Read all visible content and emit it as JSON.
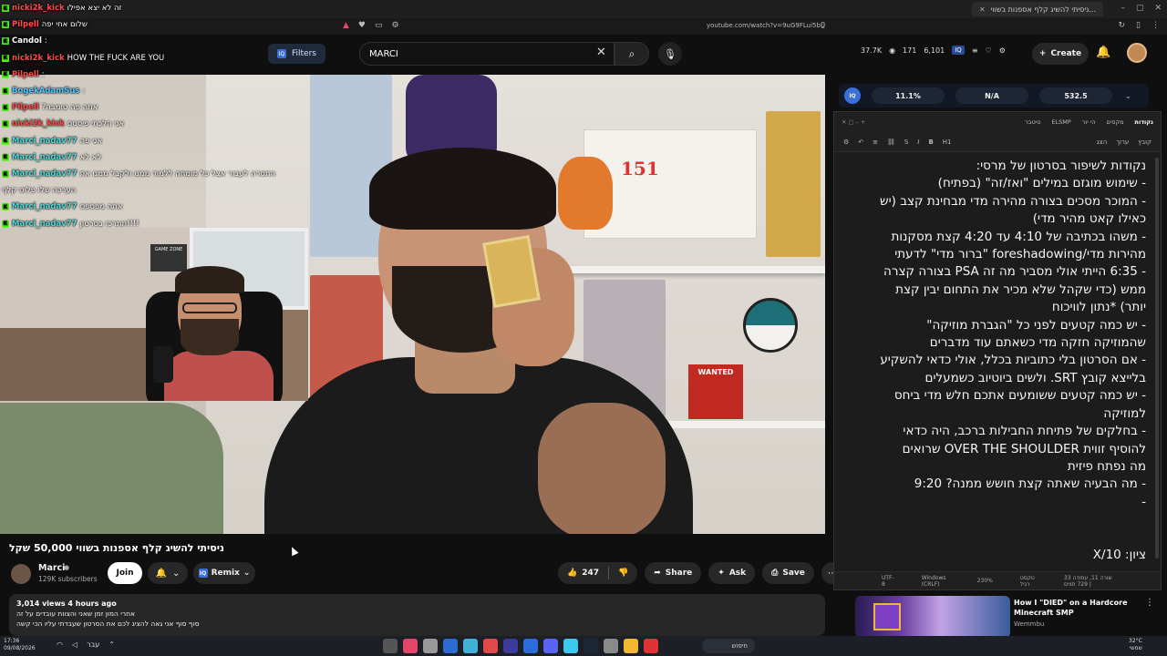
{
  "browser": {
    "tab_title": "ניסיתי להשיג קלף אספנות בשווי...",
    "url": "youtube.com/watch?v=9uG9FLui5bU"
  },
  "header": {
    "filters_label": "Filters",
    "search_value": "MARCI",
    "create_label": "Create",
    "ext_stats": {
      "views": "37.7K",
      "watching": "171",
      "other": "6,101"
    }
  },
  "chat": [
    {
      "user": "nicki2k_kick",
      "message": "זה לא יצא אפילו",
      "color": "#ff4a4a"
    },
    {
      "user": "Pilpell",
      "message": "שלום אחי יפה",
      "color": "#ff4a4a"
    },
    {
      "user": "Candol",
      "message": ":",
      "color": "#ffffff"
    },
    {
      "user": "nicki2k_kick",
      "message": "HOW THE FUCK ARE YOU",
      "color": "#ff4a4a"
    },
    {
      "user": "Pilpell",
      "message": ":",
      "color": "#ff4a4a"
    },
    {
      "user": "BogekAdamSus",
      "message": ":",
      "color": "#53c9ff"
    },
    {
      "user": "Pilpell",
      "message": "?אתה פה טומבה",
      "color": "#ff4a4a"
    },
    {
      "user": "nicki2k_kick",
      "message": "אני הלכתי פיססס",
      "color": "#ff4a4a"
    },
    {
      "user": "Marci_nadav77",
      "message": "אני פה",
      "color": "#4fd7d7"
    },
    {
      "user": "Marci_nadav77",
      "message": "לא לא",
      "color": "#4fd7d7"
    },
    {
      "user": "Marci_nadav77",
      "message": "התסרה לעבור אצל כל מומחה ללמוד ממנו ולקבל ממנו את",
      "color": "#4fd7d7"
    },
    {
      "user": "",
      "message": "הערכה שלו פלוס קלף",
      "color": "#ffffff"
    },
    {
      "user": "Marci_nadav77",
      "message": "אתה מפספס",
      "color": "#4fd7d7"
    },
    {
      "user": "Marci_nadav77",
      "message": "תתרכז בסרטון!!!!",
      "color": "#4fd7d7"
    }
  ],
  "video": {
    "title": "ניסיתי להשיג קלף אספנות בשווי 50,000 שקל",
    "channel": "Marci",
    "subscribers": "129K subscribers",
    "join_label": "Join",
    "remix_label": "Remix",
    "likes": "247",
    "share_label": "Share",
    "ask_label": "Ask",
    "save_label": "Save",
    "views_meta": "3,014 views  4 hours ago",
    "desc_line1": "אחרי המון זמן שאני והצוות עובדים על זה",
    "desc_line2": "סוף סוף אני גאה להציג לכם את הסרטון שעבדתי עליו הכי קשה",
    "scene_box_label": "151",
    "scene_wanted": "WANTED",
    "scene_gamezone": "GAME ZONE"
  },
  "extension": {
    "v1": "11.1%",
    "v2": "N/A",
    "v3": "532.5"
  },
  "notepad": {
    "tabs": [
      "טיטבר",
      "ELSMP",
      "הי יור",
      "מקסים",
      "נקודות"
    ],
    "menu": [
      "קובץ",
      "ערוך",
      "הצג"
    ],
    "heading_label": "H1",
    "lines": [
      "נקודות לשיפור בסרטון של מרסי:",
      "- שימוש מוגזם במילים \"ואז/זה\" (בפתיח)",
      "- המוכר מסכים בצורה מהירה מדי מבחינת קצב (יש",
      "כאילו קאט מהיר מדי)",
      "- משהו בכתיבה של 4:10 עד 4:20 קצת מסקנות",
      "מהירות מדי/foreshadowing \"ברור מדי\" לדעתי",
      "- 6:35 הייתי אולי מסביר מה זה PSA בצורה קצרה",
      "ממש (כדי שקהל שלא מכיר את התחום יבין קצת",
      "יותר) *נתון לוויכוח",
      "- יש כמה קטעים לפני כל \"הגברת מוזיקה\"",
      "שהמוזיקה חזקה מדי כשאתם עוד מדברים",
      "- אם הסרטון בלי כתוביות בכלל, אולי כדאי להשקיע",
      "בלייצא קובץ SRT. ולשים ביוטיוב כשמעלים",
      "- יש כמה קטעים ששומעים אתכם חלש מדי ביחס",
      "למוזיקה",
      "- בחלקים של פתיחת החבילות ברכב, היה כדאי",
      "להוסיף זווית OVER THE SHOULDER שרואים",
      "מה נפתח פיזית",
      "- מה הבעיה שאתה קצת חושש ממנה? 9:20",
      "-",
      "",
      "",
      "ציון: X/10"
    ],
    "status": [
      "שורה 11, עמודה 33 | 729 תווים",
      "טקסט רגיל",
      "230%",
      "Windows (CRLF)",
      "UTF-8"
    ]
  },
  "recommendation": {
    "title": "How I \"DIED\" on a Hardcore Minecraft SMP",
    "channel": "Wemmbu"
  },
  "taskbar": {
    "time": "17:36",
    "date": "09/08/2026",
    "search_label": "חיפוש",
    "lang": "עבר",
    "weather_temp": "32°C",
    "weather_desc": "שמשי"
  }
}
